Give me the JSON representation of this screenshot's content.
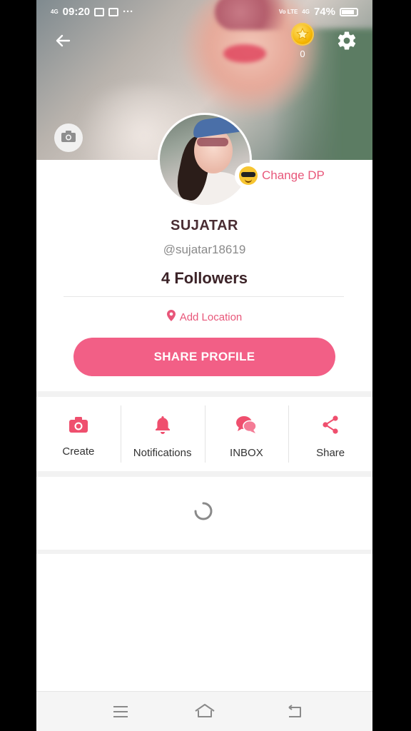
{
  "status_bar": {
    "network": "4G",
    "time": "09:20",
    "extra": "···",
    "volte": "Vo LTE",
    "network_right": "4G",
    "battery": "74%"
  },
  "header": {
    "coin_count": "0"
  },
  "profile": {
    "change_dp_label": "Change DP",
    "name": "SUJATAR",
    "handle": "@sujatar18619",
    "followers": "4 Followers",
    "add_location": "Add Location",
    "share_profile": "SHARE PROFILE"
  },
  "actions": [
    {
      "label": "Create",
      "icon": "camera-icon"
    },
    {
      "label": "Notifications",
      "icon": "bell-icon"
    },
    {
      "label": "INBOX",
      "icon": "chat-bubbles-icon"
    },
    {
      "label": "Share",
      "icon": "share-icon"
    }
  ],
  "colors": {
    "accent": "#f25f86",
    "accent_text": "#e8577a",
    "name_text": "#4a2d33"
  }
}
